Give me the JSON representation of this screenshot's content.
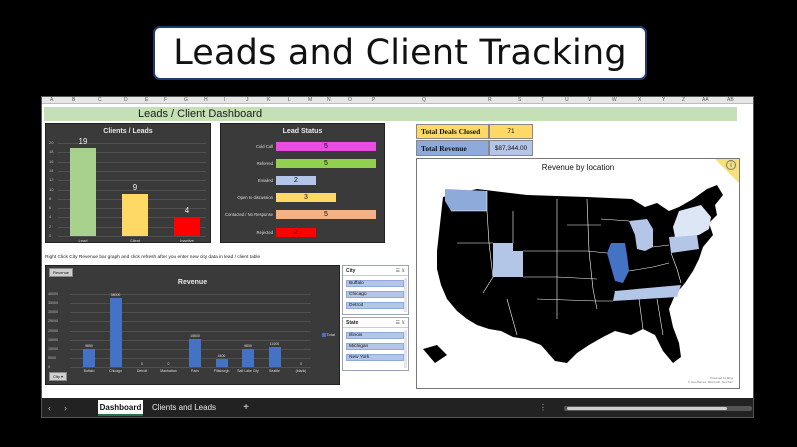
{
  "banner": {
    "title": "Leads and Client Tracking"
  },
  "columns": [
    "A",
    "B",
    "C",
    "D",
    "E",
    "F",
    "G",
    "H",
    "I",
    "J",
    "K",
    "L",
    "M",
    "N",
    "O",
    "P",
    "Q",
    "R",
    "S",
    "T",
    "U",
    "V",
    "W",
    "X",
    "Y",
    "Z",
    "AA",
    "AB"
  ],
  "dashboard": {
    "title": "Leads / Client Dashboard",
    "note": "Right Click City Revenue bar graph and click refresh after you enter new city data in lead / client table"
  },
  "clients_leads": {
    "title": "Clients / Leads",
    "y_ticks": [
      "20",
      "18",
      "16",
      "14",
      "12",
      "10",
      "8",
      "6",
      "4",
      "2",
      "0"
    ],
    "chart_data": {
      "type": "bar",
      "title": "Clients / Leads",
      "categories": [
        "Lead",
        "Client",
        "Inactive"
      ],
      "values": [
        19,
        9,
        4
      ],
      "colors": [
        "#a9d18e",
        "#ffd966",
        "#ff0000"
      ],
      "ylim": [
        0,
        20
      ]
    }
  },
  "lead_status": {
    "title": "Lead Status",
    "chart_data": {
      "type": "bar",
      "title": "Lead Status",
      "categories": [
        "Cold Call",
        "Referred",
        "Emailed",
        "Open to discussion",
        "Contacted / No Response",
        "Rejected"
      ],
      "values": [
        5,
        5,
        2,
        3,
        5,
        2
      ],
      "colors": [
        "#e84ce0",
        "#92d050",
        "#b4c6e7",
        "#ffd966",
        "#f4b183",
        "#ff0000"
      ],
      "xlim": [
        0,
        5
      ]
    }
  },
  "kpis": {
    "deals_label": "Total Deals Closed",
    "deals_value": "71",
    "revenue_label": "Total Revenue",
    "revenue_value": "$87,344.00"
  },
  "map": {
    "title": "Revenue by location",
    "credit_line1": "Powered by Bing",
    "credit_line2": "© GeoNames, Microsoft, TomTom",
    "highlight_color": "#4472c4",
    "light_color": "#b4c6e7"
  },
  "revenue": {
    "title": "Revenue",
    "button": "Revenue",
    "city_button": "City",
    "legend": "Total",
    "y_ticks": [
      "40000",
      "35000",
      "30000",
      "25000",
      "20000",
      "15000",
      "10000",
      "5000",
      "0"
    ],
    "chart_data": {
      "type": "bar",
      "title": "Revenue",
      "categories": [
        "Buffalo",
        "Chicago",
        "Detroit",
        "Manhattan",
        "Paris",
        "Pittsburgh",
        "Salt Lake City",
        "Seattle",
        "(blank)"
      ],
      "values": [
        9850,
        38000,
        0,
        0,
        15500,
        4400,
        9800,
        11000,
        0
      ],
      "labels": [
        "9850",
        "38000",
        "0",
        "0",
        "15500",
        "4400",
        "9800",
        "11000",
        "0"
      ],
      "ylim": [
        0,
        40000
      ]
    }
  },
  "slicer_city": {
    "title": "City",
    "items": [
      "Buffalo",
      "Chicago",
      "Detroit"
    ]
  },
  "slicer_state": {
    "title": "State",
    "items": [
      "Illinois",
      "Michigan",
      "New York"
    ]
  },
  "tabs": {
    "active": "Dashboard",
    "other": "Clients and Leads",
    "add": "+",
    "prev": "‹",
    "next": "›",
    "more": "⋮"
  }
}
